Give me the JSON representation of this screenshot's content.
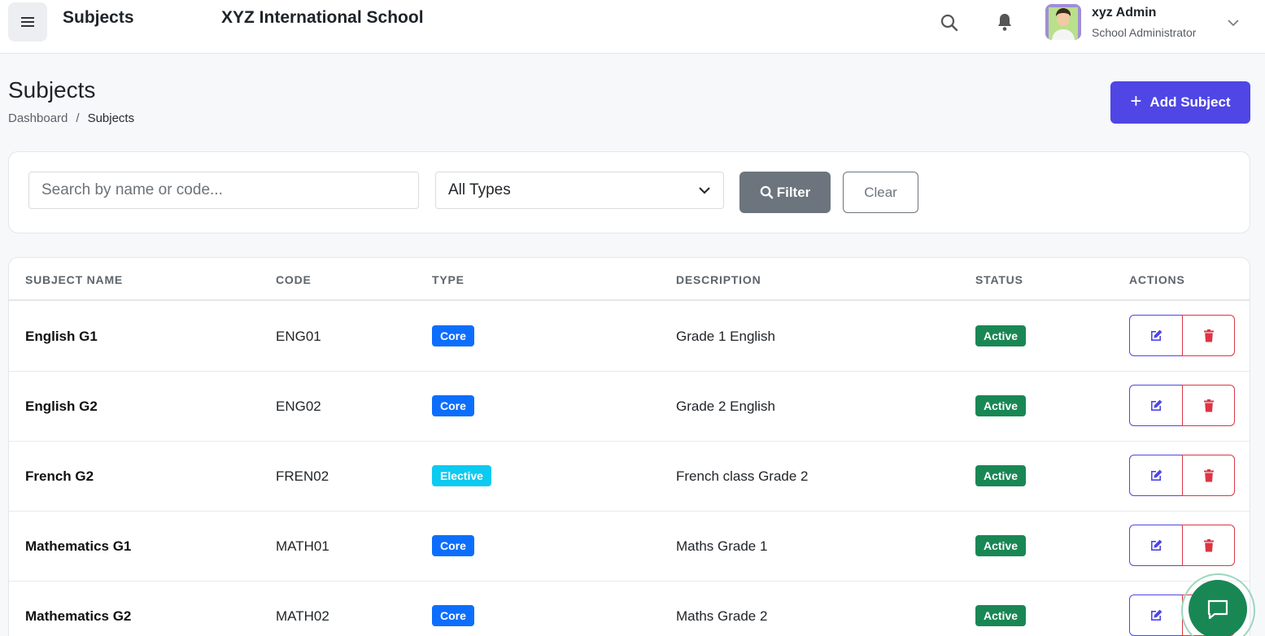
{
  "header": {
    "title": "Subjects",
    "school_name": "XYZ International School",
    "user": {
      "name": "xyz Admin",
      "role": "School Administrator"
    }
  },
  "page": {
    "title": "Subjects",
    "breadcrumb": [
      "Dashboard",
      "/",
      "Subjects"
    ],
    "add_button_label": "Add Subject"
  },
  "filters": {
    "search_placeholder": "Search by name or code...",
    "type_selected": "All Types",
    "filter_label": "Filter",
    "clear_label": "Clear"
  },
  "table": {
    "columns": [
      "SUBJECT NAME",
      "CODE",
      "TYPE",
      "DESCRIPTION",
      "STATUS",
      "ACTIONS"
    ],
    "rows": [
      {
        "name": "English G1",
        "code": "ENG01",
        "type": "Core",
        "description": "Grade 1 English",
        "status": "Active"
      },
      {
        "name": "English G2",
        "code": "ENG02",
        "type": "Core",
        "description": "Grade 2 English",
        "status": "Active"
      },
      {
        "name": "French G2",
        "code": "FREN02",
        "type": "Elective",
        "description": "French class Grade 2",
        "status": "Active"
      },
      {
        "name": "Mathematics G1",
        "code": "MATH01",
        "type": "Core",
        "description": "Maths Grade 1",
        "status": "Active"
      },
      {
        "name": "Mathematics G2",
        "code": "MATH02",
        "type": "Core",
        "description": "Maths Grade 2",
        "status": "Active"
      }
    ]
  },
  "icons": {
    "menu": "hamburger-icon",
    "search": "search-icon",
    "notifications": "bell-icon",
    "user_menu": "chevron-down-icon",
    "edit": "edit-icon",
    "delete": "trash-icon",
    "chat": "chat-icon"
  },
  "colors": {
    "primary": "#4f46e5",
    "core_badge": "#0d6efd",
    "elective_badge": "#0dcaf0",
    "active_badge": "#198754",
    "danger": "#dc3545",
    "secondary": "#6c757d"
  }
}
